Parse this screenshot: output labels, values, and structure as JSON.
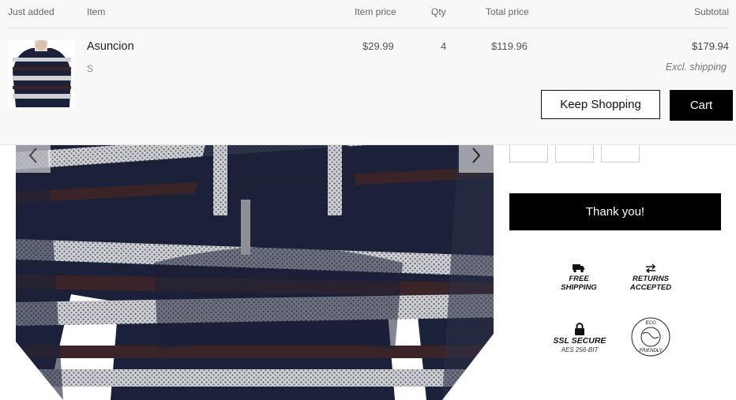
{
  "cart_drawer": {
    "headers": {
      "just_added": "Just added",
      "item": "Item",
      "item_price": "Item price",
      "qty": "Qty",
      "total_price": "Total price",
      "subtotal": "Subtotal"
    },
    "line_item": {
      "name": "Asuncion",
      "variant": "S",
      "item_price": "$29.99",
      "qty": "4",
      "total_price": "$119.96"
    },
    "subtotal": "$179.94",
    "shipping_note": "Excl. shipping",
    "keep_shopping_label": "Keep Shopping",
    "cart_label": "Cart"
  },
  "product": {
    "thank_you_label": "Thank you!"
  },
  "badges": {
    "free_shipping": [
      "FREE",
      "SHIPPING"
    ],
    "returns": [
      "RETURNS",
      "ACCEPTED"
    ],
    "ssl": "SSL SECURE",
    "ssl_sub": "AES 256-BIT",
    "eco_top": "ECO",
    "eco_bottom": "FRIENDLY"
  },
  "icons": {
    "prev": "chevron-left-icon",
    "next": "chevron-right-icon",
    "truck": "truck-icon",
    "swap": "swap-arrows-icon",
    "lock": "lock-icon",
    "eco": "eco-globe-icon"
  },
  "colors": {
    "button_dark": "#000000",
    "drawer_bg": "#f8f8f8",
    "stripe_navy": "#1b2138",
    "stripe_brown": "#3a2428",
    "stripe_white": "#d8d8da"
  }
}
